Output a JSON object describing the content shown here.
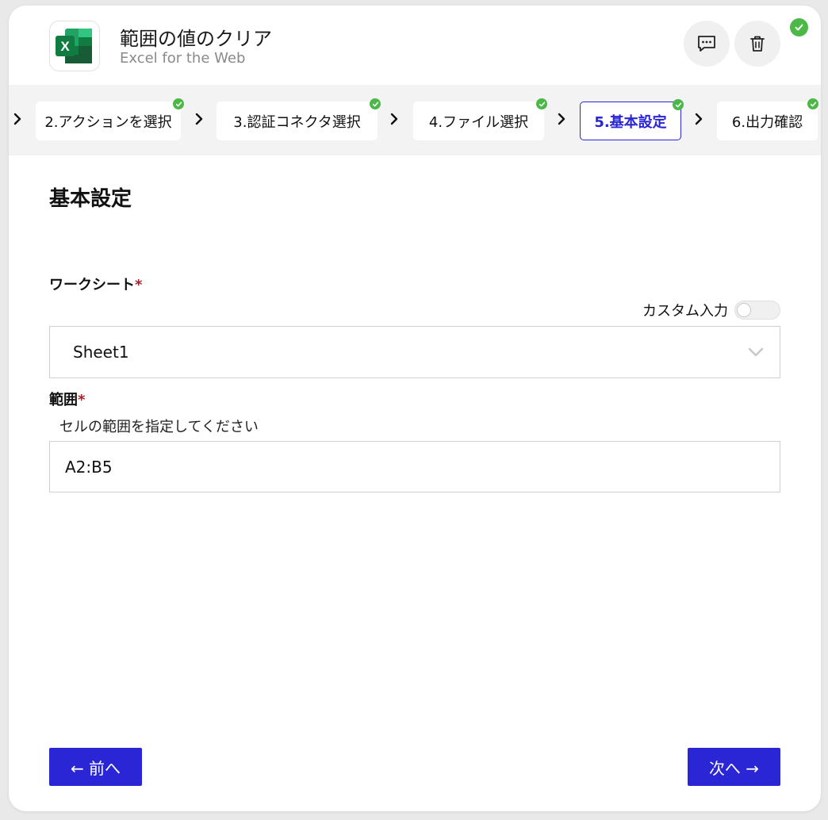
{
  "header": {
    "title": "範囲の値のクリア",
    "subtitle": "Excel for the Web",
    "logo_icon": "excel-logo-icon",
    "comment_icon": "comment-icon",
    "delete_icon": "trash-icon",
    "status_icon": "check-circle-icon"
  },
  "steps": [
    {
      "label": "2.アクションを選択",
      "completed": true,
      "active": false
    },
    {
      "label": "3.認証コネクタ選択",
      "completed": true,
      "active": false
    },
    {
      "label": "4.ファイル選択",
      "completed": true,
      "active": false
    },
    {
      "label": "5.基本設定",
      "completed": true,
      "active": true
    },
    {
      "label": "6.出力確認",
      "completed": true,
      "active": false
    }
  ],
  "section": {
    "title": "基本設定"
  },
  "worksheet": {
    "label": "ワークシート",
    "required_mark": "*",
    "custom_input_label": "カスタム入力",
    "custom_input_on": false,
    "selected_value": "Sheet1"
  },
  "range": {
    "label": "範囲",
    "required_mark": "*",
    "hint": "セルの範囲を指定してください",
    "value": "A2:B5"
  },
  "nav": {
    "prev_label": "← 前へ",
    "next_label": "次へ →"
  },
  "colors": {
    "accent": "#2a26d6",
    "success": "#4cb848",
    "required": "#a1242a"
  }
}
